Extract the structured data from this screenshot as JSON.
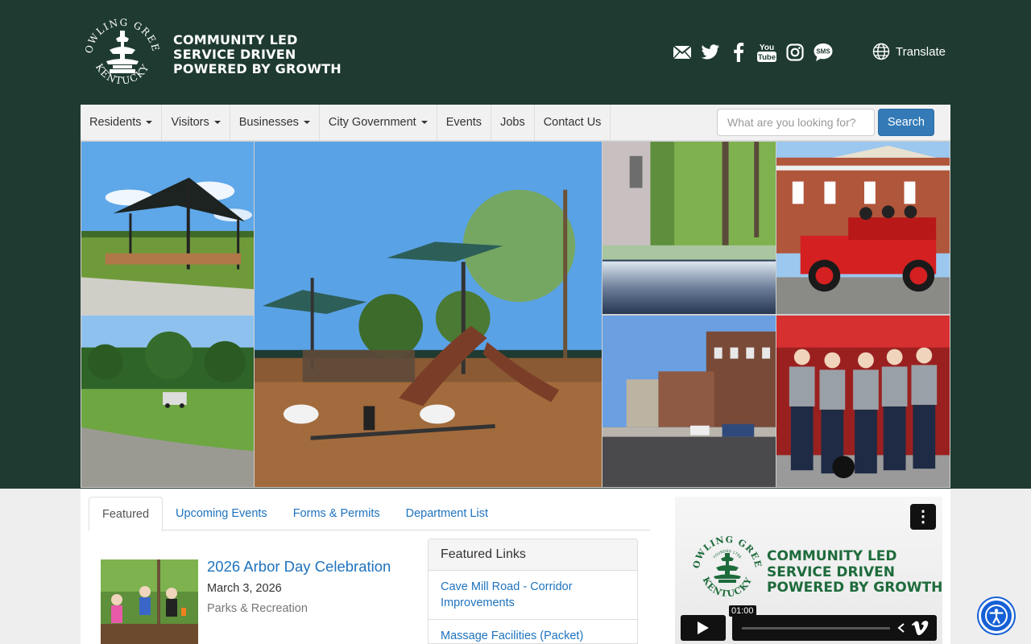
{
  "header": {
    "seal_text_top": "BOWLING GREEN",
    "seal_text_bottom": "KENTUCKY",
    "tagline": [
      "COMMUNITY LED",
      "SERVICE DRIVEN",
      "POWERED BY GROWTH"
    ],
    "social_icons": [
      "email-icon",
      "twitter-icon",
      "facebook-icon",
      "youtube-icon",
      "instagram-icon",
      "sms-icon"
    ],
    "youtube_text": "You Tube",
    "sms_text": "SMS",
    "translate_label": "Translate"
  },
  "nav": {
    "items": [
      {
        "label": "Residents",
        "dropdown": true
      },
      {
        "label": "Visitors",
        "dropdown": true
      },
      {
        "label": "Businesses",
        "dropdown": true
      },
      {
        "label": "City Government",
        "dropdown": true
      },
      {
        "label": "Events",
        "dropdown": false
      },
      {
        "label": "Jobs",
        "dropdown": false
      },
      {
        "label": "Contact Us",
        "dropdown": false
      }
    ],
    "search_placeholder": "What are you looking for?",
    "search_button": "Search"
  },
  "tabs": [
    "Featured",
    "Upcoming Events",
    "Forms & Permits",
    "Department List"
  ],
  "featured_news": {
    "title": "2026 Arbor Day Celebration",
    "date": "March 3, 2026",
    "department": "Parks & Recreation"
  },
  "featured_links": {
    "heading": "Featured Links",
    "items": [
      "Cave Mill Road - Corridor Improvements",
      "Massage Facilities (Packet)"
    ]
  },
  "video": {
    "logo_lines": [
      "COMMUNITY LED",
      "SERVICE DRIVEN",
      "POWERED BY GROWTH"
    ],
    "seal_text_top": "BOWLING GREEN",
    "seal_text_bottom": "KENTUCKY",
    "founded_text": "FOUNDED 1798",
    "timestamp": "01:00",
    "menu_icon": "more-vertical-icon"
  },
  "colors": {
    "header_bg": "#1e3a31",
    "link": "#1e73be",
    "search_button": "#337ab7",
    "accessibility": "#1560d6"
  }
}
